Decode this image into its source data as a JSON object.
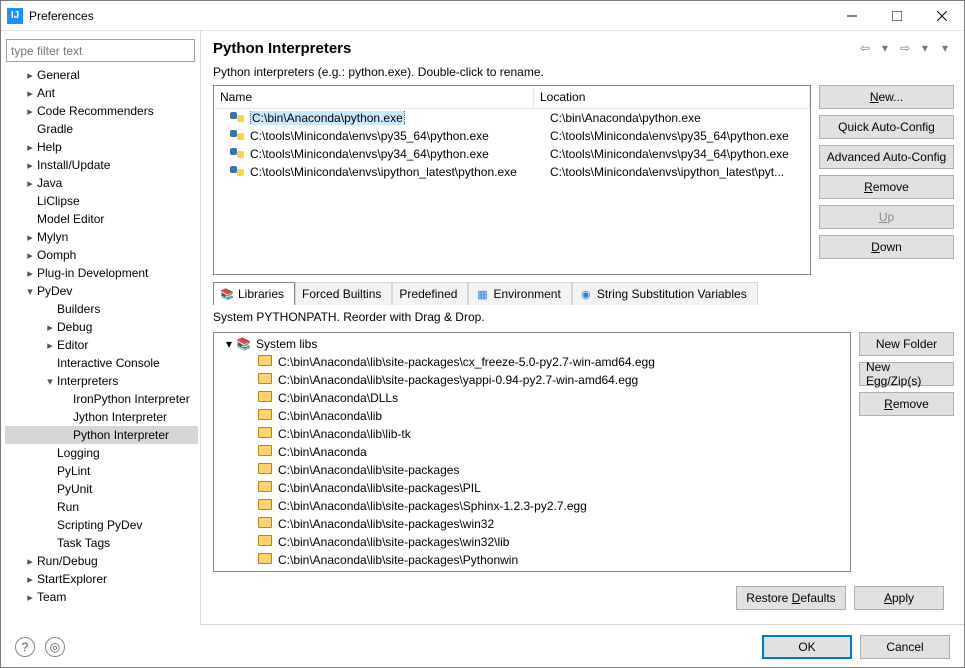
{
  "window": {
    "title": "Preferences"
  },
  "filter_placeholder": "type filter text",
  "tree": [
    {
      "label": "General",
      "depth": 0,
      "expandable": true,
      "expanded": false
    },
    {
      "label": "Ant",
      "depth": 0,
      "expandable": true,
      "expanded": false
    },
    {
      "label": "Code Recommenders",
      "depth": 0,
      "expandable": true,
      "expanded": false
    },
    {
      "label": "Gradle",
      "depth": 0,
      "expandable": false
    },
    {
      "label": "Help",
      "depth": 0,
      "expandable": true,
      "expanded": false
    },
    {
      "label": "Install/Update",
      "depth": 0,
      "expandable": true,
      "expanded": false
    },
    {
      "label": "Java",
      "depth": 0,
      "expandable": true,
      "expanded": false
    },
    {
      "label": "LiClipse",
      "depth": 0,
      "expandable": false
    },
    {
      "label": "Model Editor",
      "depth": 0,
      "expandable": false
    },
    {
      "label": "Mylyn",
      "depth": 0,
      "expandable": true,
      "expanded": false
    },
    {
      "label": "Oomph",
      "depth": 0,
      "expandable": true,
      "expanded": false
    },
    {
      "label": "Plug-in Development",
      "depth": 0,
      "expandable": true,
      "expanded": false
    },
    {
      "label": "PyDev",
      "depth": 0,
      "expandable": true,
      "expanded": true
    },
    {
      "label": "Builders",
      "depth": 1,
      "expandable": false
    },
    {
      "label": "Debug",
      "depth": 1,
      "expandable": true,
      "expanded": false
    },
    {
      "label": "Editor",
      "depth": 1,
      "expandable": true,
      "expanded": false
    },
    {
      "label": "Interactive Console",
      "depth": 1,
      "expandable": false
    },
    {
      "label": "Interpreters",
      "depth": 1,
      "expandable": true,
      "expanded": true
    },
    {
      "label": "IronPython Interpreter",
      "depth": 2,
      "expandable": false
    },
    {
      "label": "Jython Interpreter",
      "depth": 2,
      "expandable": false
    },
    {
      "label": "Python Interpreter",
      "depth": 2,
      "expandable": false,
      "selected": true
    },
    {
      "label": "Logging",
      "depth": 1,
      "expandable": false
    },
    {
      "label": "PyLint",
      "depth": 1,
      "expandable": false
    },
    {
      "label": "PyUnit",
      "depth": 1,
      "expandable": false
    },
    {
      "label": "Run",
      "depth": 1,
      "expandable": false
    },
    {
      "label": "Scripting PyDev",
      "depth": 1,
      "expandable": false
    },
    {
      "label": "Task Tags",
      "depth": 1,
      "expandable": false
    },
    {
      "label": "Run/Debug",
      "depth": 0,
      "expandable": true,
      "expanded": false
    },
    {
      "label": "StartExplorer",
      "depth": 0,
      "expandable": true,
      "expanded": false
    },
    {
      "label": "Team",
      "depth": 0,
      "expandable": true,
      "expanded": false
    }
  ],
  "page": {
    "title": "Python Interpreters",
    "description": "Python interpreters (e.g.: python.exe).   Double-click to rename."
  },
  "interp_table": {
    "headers": {
      "name": "Name",
      "location": "Location"
    },
    "rows": [
      {
        "name": "C:\\bin\\Anaconda\\python.exe",
        "location": "C:\\bin\\Anaconda\\python.exe",
        "selected": true
      },
      {
        "name": "C:\\tools\\Miniconda\\envs\\py35_64\\python.exe",
        "location": "C:\\tools\\Miniconda\\envs\\py35_64\\python.exe"
      },
      {
        "name": "C:\\tools\\Miniconda\\envs\\py34_64\\python.exe",
        "location": "C:\\tools\\Miniconda\\envs\\py34_64\\python.exe"
      },
      {
        "name": "C:\\tools\\Miniconda\\envs\\ipython_latest\\python.exe",
        "location": "C:\\tools\\Miniconda\\envs\\ipython_latest\\pyt..."
      }
    ]
  },
  "side_buttons": {
    "new": "New...",
    "quick": "Quick Auto-Config",
    "advanced": "Advanced Auto-Config",
    "remove": "Remove",
    "up": "Up",
    "down": "Down"
  },
  "tabs": {
    "libraries": "Libraries",
    "forced": "Forced Builtins",
    "predefined": "Predefined",
    "environment": "Environment",
    "strsub": "String Substitution Variables"
  },
  "lib_desc": "System PYTHONPATH.   Reorder with Drag & Drop.",
  "lib_root": "System libs",
  "lib_paths": [
    "C:\\bin\\Anaconda\\lib\\site-packages\\cx_freeze-5.0-py2.7-win-amd64.egg",
    "C:\\bin\\Anaconda\\lib\\site-packages\\yappi-0.94-py2.7-win-amd64.egg",
    "C:\\bin\\Anaconda\\DLLs",
    "C:\\bin\\Anaconda\\lib",
    "C:\\bin\\Anaconda\\lib\\lib-tk",
    "C:\\bin\\Anaconda",
    "C:\\bin\\Anaconda\\lib\\site-packages",
    "C:\\bin\\Anaconda\\lib\\site-packages\\PIL",
    "C:\\bin\\Anaconda\\lib\\site-packages\\Sphinx-1.2.3-py2.7.egg",
    "C:\\bin\\Anaconda\\lib\\site-packages\\win32",
    "C:\\bin\\Anaconda\\lib\\site-packages\\win32\\lib",
    "C:\\bin\\Anaconda\\lib\\site-packages\\Pythonwin"
  ],
  "side_buttons2": {
    "newfolder": "New Folder",
    "newegg": "New Egg/Zip(s)",
    "remove": "Remove"
  },
  "footer": {
    "restore": "Restore Defaults",
    "apply": "Apply",
    "ok": "OK",
    "cancel": "Cancel"
  }
}
